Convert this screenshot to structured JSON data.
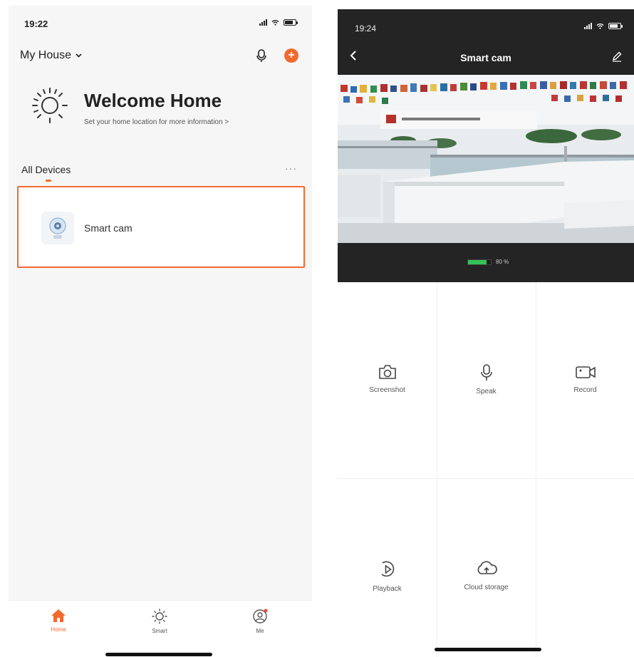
{
  "left_screen": {
    "status_bar": {
      "time": "19:22"
    },
    "home_selector": {
      "label": "My House",
      "icon": "chevron-down-icon"
    },
    "header_actions": {
      "mic_icon": "microphone-icon",
      "add_icon": "add-icon",
      "add_glyph": "+"
    },
    "welcome": {
      "title": "Welcome Home",
      "subtitle": "Set your home location for more information >",
      "icon": "sun-icon"
    },
    "devices_section": {
      "title": "All Devices",
      "more_icon": "more-icon",
      "more_glyph": "···"
    },
    "devices": [
      {
        "name": "Smart cam",
        "icon": "smart-cam-icon"
      }
    ],
    "tabs": [
      {
        "label": "Home",
        "icon": "home-icon",
        "active": true
      },
      {
        "label": "Smart",
        "icon": "sun-icon",
        "active": false
      },
      {
        "label": "Me",
        "icon": "user-icon",
        "active": false
      }
    ],
    "accent_color": "#f26a2e"
  },
  "right_screen": {
    "status_bar": {
      "time": "19:24"
    },
    "nav": {
      "title": "Smart cam",
      "back_icon": "chevron-left-icon",
      "edit_icon": "edit-icon"
    },
    "battery": {
      "level_percent": 80,
      "text": "80 %"
    },
    "controls": [
      {
        "label": "Screenshot",
        "icon": "camera-icon"
      },
      {
        "label": "Speak",
        "icon": "microphone-icon"
      },
      {
        "label": "Record",
        "icon": "video-camera-icon"
      },
      {
        "label": "Playback",
        "icon": "playback-icon"
      },
      {
        "label": "Cloud storage",
        "icon": "cloud-storage-icon"
      }
    ],
    "header_color": "#242424",
    "battery_color": "#36c25a"
  }
}
